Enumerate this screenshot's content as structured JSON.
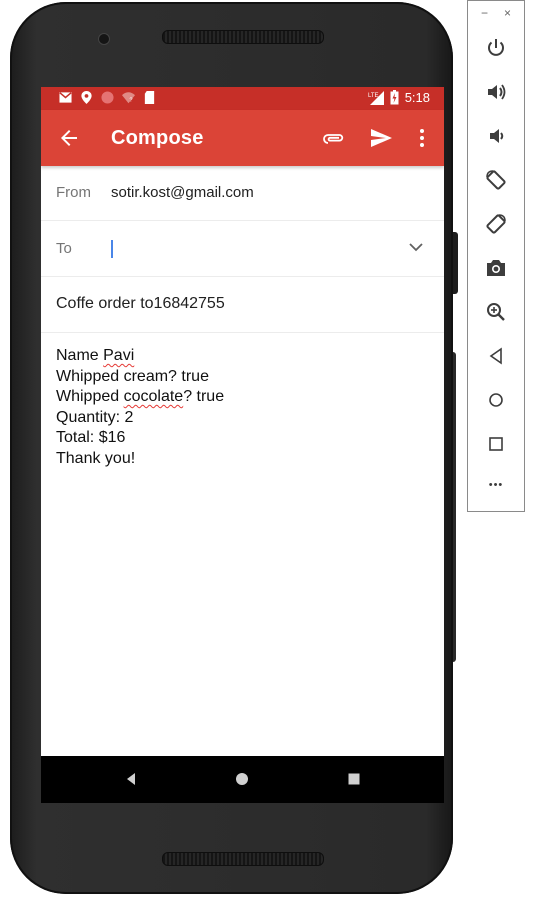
{
  "status_bar": {
    "time": "5:18",
    "network": "LTE",
    "icons": [
      "gmail-icon",
      "location-icon",
      "sync-dot-icon",
      "wifi-question-icon",
      "sd-card-icon",
      "signal-icon",
      "battery-icon"
    ]
  },
  "app_bar": {
    "title": "Compose",
    "actions": [
      "attach-icon",
      "send-icon",
      "more-vert-icon"
    ]
  },
  "compose": {
    "from_label": "From",
    "from_value": "sotir.kost@gmail.com",
    "to_label": "To",
    "to_value": "",
    "subject": "Coffe order to16842755"
  },
  "body_lines": {
    "l1a": "Name ",
    "l1b": "Pavi",
    "l2": "Whipped cream? true",
    "l3a": "Whipped ",
    "l3b": "cocolate",
    "l3c": "? true",
    "l4": "Quantity: 2",
    "l5": "Total: $16",
    "l6": "Thank you!"
  },
  "emulator_toolbar": {
    "minimize": "−",
    "close": "×",
    "more": "•••",
    "buttons": [
      "power-icon",
      "volume-up-icon",
      "volume-down-icon",
      "rotate-left-icon",
      "rotate-right-icon",
      "screenshot-icon",
      "zoom-icon",
      "back-icon",
      "home-icon",
      "overview-icon",
      "more-icon"
    ]
  },
  "colors": {
    "status_bar": "#c62f28",
    "app_bar": "#db4437",
    "cursor": "#4a86e8",
    "spell_error": "#e53935"
  }
}
